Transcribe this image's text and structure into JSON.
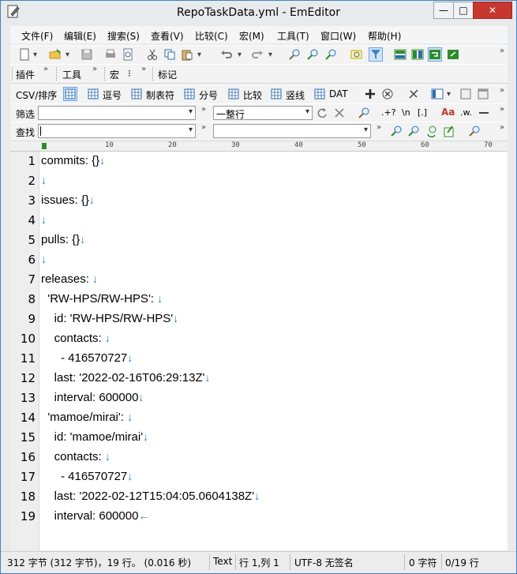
{
  "window": {
    "title": "RepoTaskData.yml - EmEditor",
    "min_glyph": "—",
    "max_glyph": "□",
    "close_glyph": "✕"
  },
  "menu": [
    "文件(F)",
    "编辑(E)",
    "搜索(S)",
    "查看(V)",
    "比较(C)",
    "宏(M)",
    "工具(T)",
    "窗口(W)",
    "帮助(H)"
  ],
  "toolbar2": {
    "plugins": "插件",
    "tools": "工具",
    "macro": "宏",
    "macro_suffix": "⁝",
    "marks": "标记"
  },
  "csvbar": {
    "csv_sort": "CSV/排序",
    "comma": "逗号",
    "tab": "制表符",
    "semicolon": "分号",
    "compare": "比较",
    "pipe": "竖线",
    "dat": "DAT"
  },
  "filterbar": {
    "label": "筛选",
    "filter_value": "",
    "mode_value": "一整行",
    "regex": ".+?",
    "newline": "\\n",
    "bracket": "[.]",
    "case": "Aa",
    "word": ".w."
  },
  "findbar": {
    "label": "查找",
    "find_value": "",
    "replace_value": ""
  },
  "ruler_ticks": [
    "10",
    "20",
    "30",
    "40",
    "50",
    "60",
    "70"
  ],
  "editor": {
    "line_numbers": [
      "1",
      "2",
      "3",
      "4",
      "5",
      "6",
      "7",
      "8",
      "9",
      "10",
      "11",
      "12",
      "13",
      "14",
      "15",
      "16",
      "17",
      "18",
      "19"
    ],
    "lines": [
      "commits: {}",
      "",
      "issues: {}",
      "",
      "pulls: {}",
      "",
      "releases: ",
      "  'RW-HPS/RW-HPS': ",
      "    id: 'RW-HPS/RW-HPS'",
      "    contacts: ",
      "      - 416570727",
      "    last: '2022-02-16T06:29:13Z'",
      "    interval: 600000",
      "  'mamoe/mirai': ",
      "    id: 'mamoe/mirai'",
      "    contacts: ",
      "      - 416570727",
      "    last: '2022-02-12T15:04:05.0604138Z'",
      "    interval: 600000"
    ],
    "eol_marks": [
      "↓",
      "↓",
      "↓",
      "↓",
      "↓",
      "↓",
      "↓",
      "↓",
      "↓",
      "↓",
      "↓",
      "↓",
      "↓",
      "↓",
      "↓",
      "↓",
      "↓",
      "↓",
      "←"
    ]
  },
  "status": {
    "summary": "312 字节 (312 字节)，19 行。 (0.016 秒)",
    "mode": "Text",
    "position": "行 1,列 1",
    "encoding": "UTF-8 无签名",
    "selected": "0 字符",
    "lines_sel": "0/19 行"
  },
  "colors": {
    "accent": "#3a83c6",
    "close": "#c7372f",
    "eol": "#1e7fd6"
  }
}
